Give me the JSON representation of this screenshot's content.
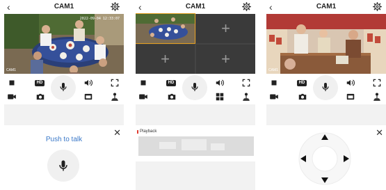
{
  "screens": [
    {
      "title": "CAM1",
      "video_timestamp": "2022-09-04 12:33:07",
      "video_camera_label": "CAM1",
      "controls_hd_label": "HD",
      "panel": "Push to talk"
    },
    {
      "title": "CAM1",
      "controls_hd_label": "HD",
      "panel": "Playback"
    },
    {
      "title": "CAM1",
      "video_camera_label": "CAM1",
      "controls_hd_label": "HD",
      "panel": "PTZ"
    }
  ],
  "icons": {
    "back": "chevron-left-icon",
    "settings": "gear-icon",
    "close": "close-icon",
    "add": "plus-icon"
  },
  "colors": {
    "push_to_talk": "#3a78c8",
    "playback_marker": "#e03c31",
    "grid_empty": "#3a3a3a"
  }
}
